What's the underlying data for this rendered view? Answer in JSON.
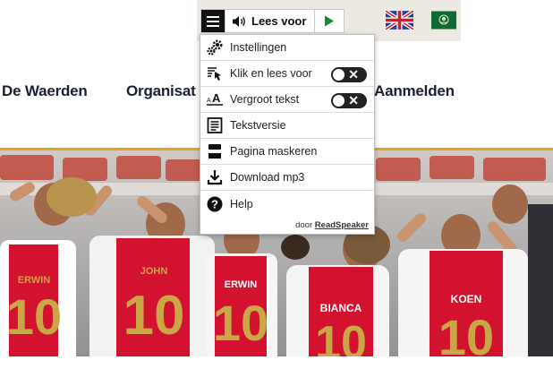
{
  "readspeaker": {
    "listen_label": "Lees voor",
    "menu": [
      {
        "label": "Instellingen",
        "icon": "settings-gears-icon",
        "toggle": false
      },
      {
        "label": "Klik en lees voor",
        "icon": "click-and-read-icon",
        "toggle": true,
        "toggle_on": false
      },
      {
        "label": "Vergroot tekst",
        "icon": "enlarge-text-icon",
        "toggle": true,
        "toggle_on": false
      },
      {
        "label": "Tekstversie",
        "icon": "text-version-icon",
        "toggle": false
      },
      {
        "label": "Pagina maskeren",
        "icon": "page-mask-icon",
        "toggle": false
      },
      {
        "label": "Download mp3",
        "icon": "download-icon",
        "toggle": false
      },
      {
        "label": "Help",
        "icon": "help-icon",
        "toggle": false
      }
    ],
    "credit_prefix": "door",
    "credit_brand": "ReadSpeaker"
  },
  "languages": [
    {
      "name": "english-flag-icon"
    },
    {
      "name": "arabic-flag-icon"
    }
  ],
  "nav": {
    "item_1": "De Waerden",
    "item_2": "Organisat",
    "item_3": "Aanmelden"
  },
  "hero": {
    "shirt_names": [
      "ERWIN",
      "JOHN",
      "ERWIN",
      "BIANCA",
      "KOEN"
    ],
    "shirt_number": "10"
  },
  "colors": {
    "accent": "#e8a31d",
    "nav_text": "#1b1f33",
    "shirt_red": "#d2122e",
    "shirt_gold": "#c9a646"
  }
}
